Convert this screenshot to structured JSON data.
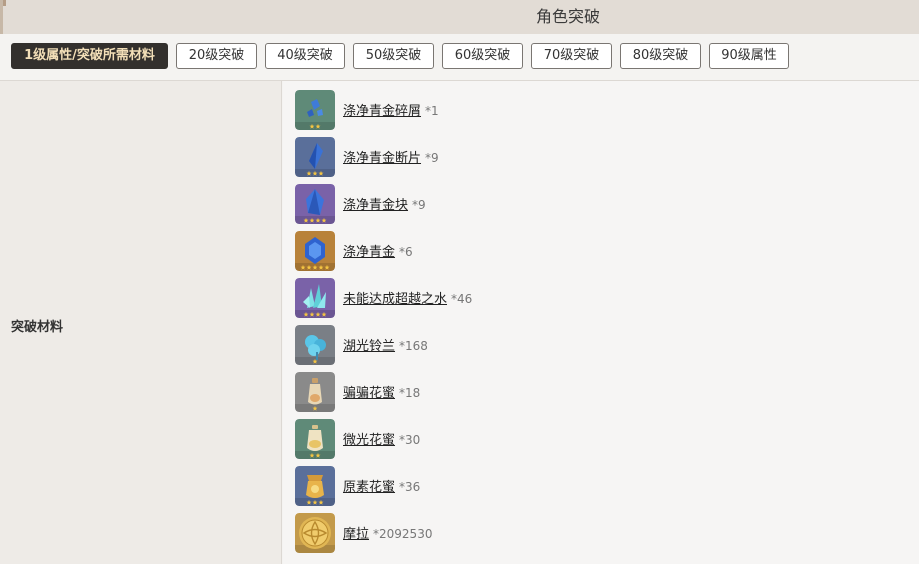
{
  "page": {
    "title": "角色突破"
  },
  "tabs": [
    {
      "label": "1级属性/突破所需材料",
      "active": true
    },
    {
      "label": "20级突破",
      "active": false
    },
    {
      "label": "40级突破",
      "active": false
    },
    {
      "label": "50级突破",
      "active": false
    },
    {
      "label": "60级突破",
      "active": false
    },
    {
      "label": "70级突破",
      "active": false
    },
    {
      "label": "80级突破",
      "active": false
    },
    {
      "label": "90级属性",
      "active": false
    }
  ],
  "section": {
    "label": "突破材料"
  },
  "materials": [
    {
      "name": "涤净青金碎屑",
      "count": "*1",
      "icon": "lapis-sliver-icon",
      "rarity": 2,
      "bg": "#5f8a78"
    },
    {
      "name": "涤净青金断片",
      "count": "*9",
      "icon": "lapis-fragment-icon",
      "rarity": 3,
      "bg": "#5a6f9a"
    },
    {
      "name": "涤净青金块",
      "count": "*9",
      "icon": "lapis-chunk-icon",
      "rarity": 4,
      "bg": "#7a62a8"
    },
    {
      "name": "涤净青金",
      "count": "*6",
      "icon": "lapis-gemstone-icon",
      "rarity": 5,
      "bg": "#b8823a"
    },
    {
      "name": "未能达成超越之水",
      "count": "*46",
      "icon": "crystal-water-icon",
      "rarity": 4,
      "bg": "#7a62a8"
    },
    {
      "name": "湖光铃兰",
      "count": "*168",
      "icon": "lakelight-lily-icon",
      "rarity": 1,
      "bg": "#7a7f86"
    },
    {
      "name": "骗骗花蜜",
      "count": "*18",
      "icon": "slime-nectar-icon",
      "rarity": 1,
      "bg": "#8a8a8a"
    },
    {
      "name": "微光花蜜",
      "count": "*30",
      "icon": "shimmering-nectar-icon",
      "rarity": 2,
      "bg": "#5f8a78"
    },
    {
      "name": "原素花蜜",
      "count": "*36",
      "icon": "energy-nectar-icon",
      "rarity": 3,
      "bg": "#5a6f9a"
    },
    {
      "name": "摩拉",
      "count": "*2092530",
      "icon": "mora-coin-icon",
      "rarity": 0,
      "bg": "#c39a4a"
    }
  ]
}
